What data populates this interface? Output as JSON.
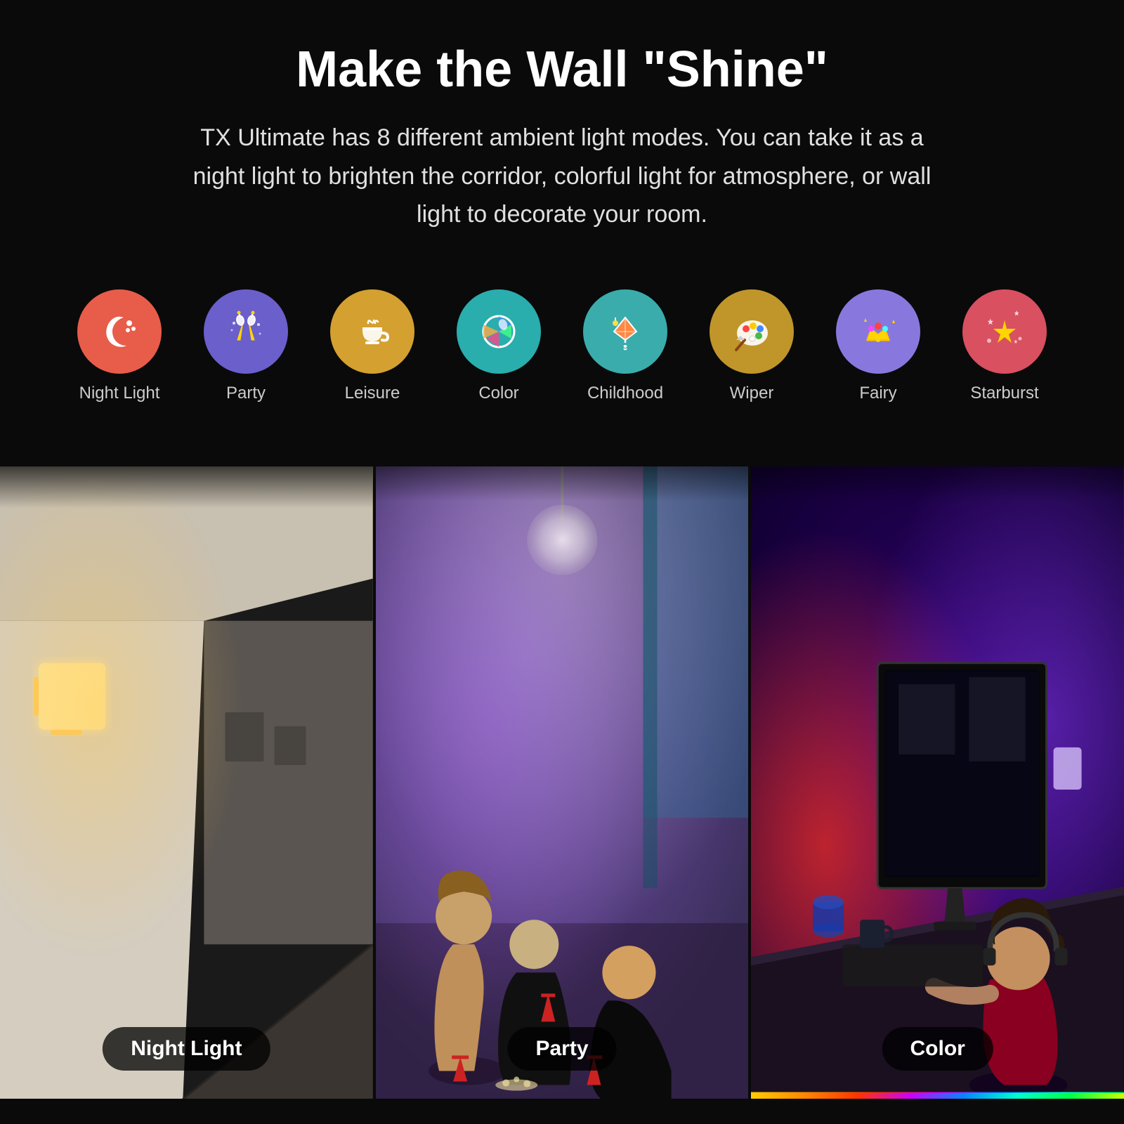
{
  "header": {
    "title": "Make the Wall \"Shine\"",
    "subtitle": "TX Ultimate has 8 different ambient light modes. You can take it as a night light to brighten the corridor, colorful light for atmosphere, or wall light to decorate your room."
  },
  "modes": [
    {
      "id": "night-light",
      "label": "Night Light",
      "emoji": "🌙",
      "color_class": "night-light-circle"
    },
    {
      "id": "party",
      "label": "Party",
      "emoji": "🥂",
      "color_class": "party-circle"
    },
    {
      "id": "leisure",
      "label": "Leisure",
      "emoji": "☕",
      "color_class": "leisure-circle"
    },
    {
      "id": "color",
      "label": "Color",
      "emoji": "🌍",
      "color_class": "color-circle"
    },
    {
      "id": "childhood",
      "label": "Childhood",
      "emoji": "🪁",
      "color_class": "childhood-circle"
    },
    {
      "id": "wiper",
      "label": "Wiper",
      "emoji": "🎨",
      "color_class": "wiper-circle"
    },
    {
      "id": "fairy",
      "label": "Fairy",
      "emoji": "👑",
      "color_class": "fairy-circle"
    },
    {
      "id": "starburst",
      "label": "Starburst",
      "emoji": "✨",
      "color_class": "starburst-circle"
    }
  ],
  "photos": [
    {
      "id": "night-light-photo",
      "badge": "Night Light"
    },
    {
      "id": "party-photo",
      "badge": "Party"
    },
    {
      "id": "color-photo",
      "badge": "Color"
    }
  ]
}
